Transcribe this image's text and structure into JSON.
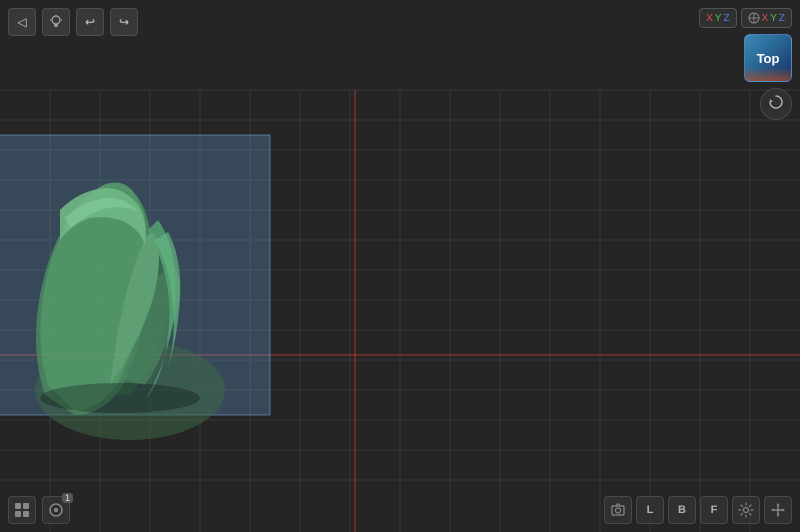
{
  "viewport": {
    "background_color": "#2a2a2a",
    "grid_color": "#3a3a3a",
    "grid_line_color": "#444",
    "red_axis_color": "#cc3333"
  },
  "toolbar": {
    "back_icon": "◁",
    "lamp_icon": "💡",
    "undo_icon": "↩",
    "redo_icon": "↪"
  },
  "top_right": {
    "axis_label_x": "X",
    "axis_label_y": "Y",
    "axis_label_z": "Z",
    "view_cube_label": "Top",
    "rotate_icon": "⟳"
  },
  "bottom_left": {
    "icon1": "⬛",
    "icon2": "◉",
    "badge": "1"
  },
  "bottom_right": {
    "label_l": "L",
    "label_b": "B",
    "label_f": "F",
    "icon_settings": "⚙",
    "icon_move": "✥"
  },
  "model": {
    "color_main": "#5db87a",
    "color_shadow": "#3d8a5a",
    "color_light": "#7ed4a0"
  }
}
